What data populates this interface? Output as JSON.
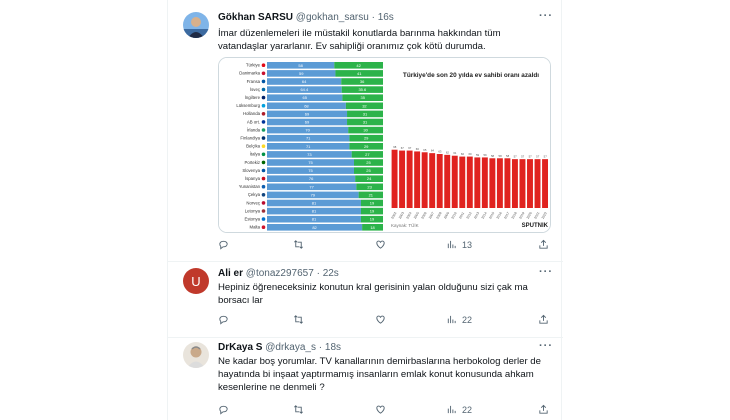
{
  "tweets": [
    {
      "name": "Gökhan SARSU",
      "handle": "@gokhan_sarsu",
      "time": "16s",
      "text": "İmar düzenlemeleri ile müstakil konutlarda barınma hakkından tüm vatandaşlar yararlanır. Ev sahipliği oranımız çok kötü durumda.",
      "replies": "",
      "retweets": "",
      "likes": "",
      "views": "13"
    },
    {
      "name": "Ali er",
      "handle": "@tonaz297657",
      "time": "22s",
      "avatar_letter": "U",
      "text": "Hepiniz öğreneceksiniz konutun kral gerisinin yalan olduğunu sizi çak ma borsacı lar",
      "replies": "",
      "retweets": "",
      "likes": "",
      "views": "22"
    },
    {
      "name": "DrKaya S",
      "handle": "@drkaya_s",
      "time": "18s",
      "text": "Ne kadar boş yorumlar. TV kanallarının demirbaslarına herbokolog derler de hayatında bi inşaat yaptırmamış insanların  emlak konut konusunda ahkam kesenlerine ne denmeli ?",
      "replies": "",
      "retweets": "",
      "likes": "",
      "views": "22"
    }
  ],
  "media": {
    "right_title": "Türkiye'de son 20 yılda ev sahibi oranı azaldı",
    "source": "Kaynak: TÜİK",
    "brand": "SPUTNIK"
  },
  "chart_data": [
    {
      "type": "bar",
      "orientation": "horizontal-stacked",
      "categories": [
        "Türkiye",
        "Danimarka",
        "Fransa",
        "İsveç",
        "İngiltere",
        "Lüksemburg",
        "Hollanda",
        "AB ort.",
        "İrlanda",
        "Finlandiya",
        "Belçika",
        "İtalya",
        "Portekiz",
        "Slovenya",
        "İspanya",
        "Yunanistan",
        "Çekya",
        "Norveç",
        "Letonya",
        "Estonya",
        "Malta"
      ],
      "series": [
        {
          "name": "",
          "values": [
            58,
            59,
            64,
            64.4,
            65,
            68,
            69,
            69,
            70,
            71,
            71,
            73,
            75,
            75,
            76,
            77,
            79,
            81,
            81,
            81,
            82
          ],
          "labels": [
            "58",
            "59",
            "64",
            "64.4",
            "65",
            "68",
            "69",
            "69",
            "70",
            "71",
            "71",
            "73",
            "75",
            "75",
            "76",
            "77",
            "79",
            "81",
            "81",
            "81",
            "82"
          ]
        },
        {
          "name": "",
          "values": [
            42,
            41,
            36,
            35.6,
            35,
            32,
            31,
            31,
            30,
            29,
            29,
            27,
            25,
            25,
            24,
            23,
            21,
            19,
            19,
            19,
            18
          ],
          "labels": [
            "42",
            "41",
            "36",
            "35.6",
            "35",
            "32",
            "31",
            "31",
            "30",
            "29",
            "29",
            "27",
            "25",
            "25",
            "24",
            "23",
            "21",
            "19",
            "19",
            "19",
            "18"
          ]
        }
      ],
      "colors": [
        "#5b9bd5",
        "#2cb34a"
      ]
    },
    {
      "type": "bar",
      "title": "Türkiye'de son 20 yılda ev sahibi oranı azaldı",
      "categories": [
        "2002",
        "2003",
        "2004",
        "2005",
        "2006",
        "2007",
        "2008",
        "2009",
        "2010",
        "2011",
        "2012",
        "2013",
        "2014",
        "2015",
        "2016",
        "2017",
        "2018",
        "2019",
        "2020",
        "2021",
        "2022"
      ],
      "values": [
        68,
        67,
        67,
        66,
        65,
        64,
        63,
        62,
        61,
        60,
        60,
        59,
        59,
        58,
        58,
        58,
        57,
        57,
        57,
        57,
        57
      ],
      "color": "#e0221f"
    }
  ]
}
